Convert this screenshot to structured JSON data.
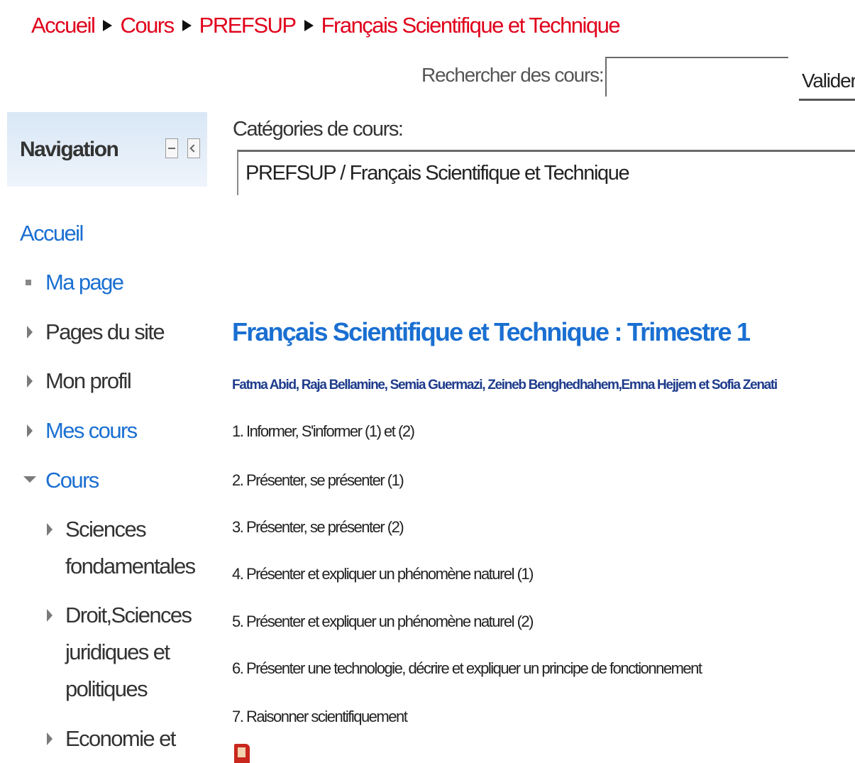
{
  "breadcrumb": {
    "items": [
      "Accueil",
      "Cours",
      "PREFSUP",
      "Français Scientifique et Technique"
    ]
  },
  "search": {
    "label": "Rechercher des cours:",
    "value": "",
    "button_label": "Valider"
  },
  "navigation": {
    "title": "Navigation",
    "home": "Accueil",
    "items": [
      {
        "label": "Ma page",
        "icon": "square-bullet-icon"
      },
      {
        "label": "Pages du site",
        "icon": "chevron-right-icon"
      },
      {
        "label": "Mon profil",
        "icon": "chevron-right-icon"
      },
      {
        "label": "Mes cours",
        "icon": "chevron-right-icon"
      },
      {
        "label": "Cours",
        "icon": "chevron-down-icon"
      }
    ],
    "subitems": [
      {
        "lines": [
          "Sciences",
          "fondamentales"
        ]
      },
      {
        "lines": [
          "Droit,Sciences",
          "juridiques et",
          "politiques"
        ]
      },
      {
        "lines": [
          "Economie et"
        ]
      }
    ]
  },
  "categories": {
    "label": "Catégories de cours:",
    "selected": "PREFSUP / Français Scientifique et Technique"
  },
  "course": {
    "title": "Français Scientifique et Technique : Trimestre 1",
    "authors": "Fatma Abid, Raja Bellamine, Semia Guermazi, Zeineb Benghedhahem,Emna Hejjem et Sofia Zenati",
    "topics": [
      "1. Informer, S'informer (1) et (2)",
      "2. Présenter, se présenter (1)",
      "3. Présenter, se présenter (2)",
      "4. Présenter et expliquer un phénomène naturel (1)",
      "5. Présenter et expliquer un phénomène naturel (2)",
      "6. Présenter une technologie, décrire et expliquer un principe de fonctionnement",
      "7. Raisonner scientifiquement"
    ]
  },
  "colors": {
    "breadcrumb": "#e0001b",
    "link": "#1a6fd1",
    "authors": "#1f3c8c",
    "nav_header_bg": "#d9e7f6"
  }
}
